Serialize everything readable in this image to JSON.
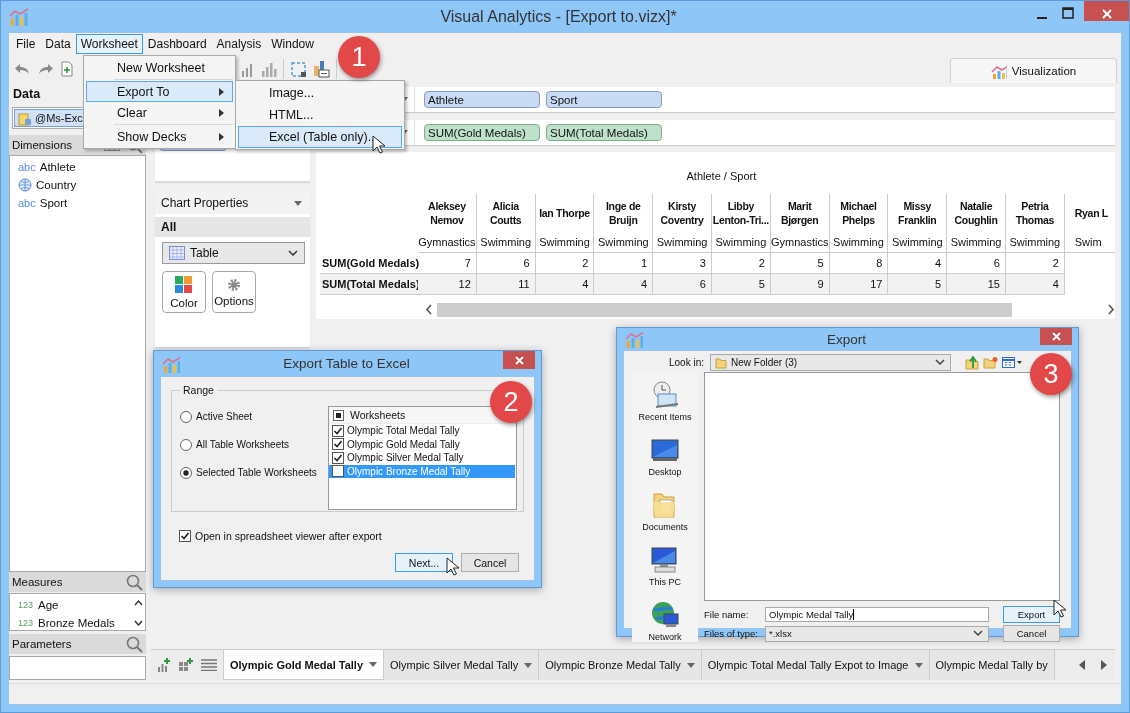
{
  "window": {
    "title": "Visual Analytics - [Export to.vizx]*"
  },
  "menu_bar": [
    {
      "label": "File",
      "selected": false
    },
    {
      "label": "Data",
      "selected": false
    },
    {
      "label": "Worksheet",
      "selected": true
    },
    {
      "label": "Dashboard",
      "selected": false
    },
    {
      "label": "Analysis",
      "selected": false
    },
    {
      "label": "Window",
      "selected": false
    }
  ],
  "worksheet_menu": [
    {
      "label": "New Worksheet",
      "submenu": false,
      "selected": false,
      "separator_after": true
    },
    {
      "label": "Export To",
      "submenu": true,
      "selected": true,
      "separator_after": false
    },
    {
      "label": "Clear",
      "submenu": true,
      "selected": false,
      "separator_after": true
    },
    {
      "label": "Show Decks",
      "submenu": true,
      "selected": false,
      "separator_after": false
    }
  ],
  "export_submenu": [
    {
      "label": "Image...",
      "selected": false
    },
    {
      "label": "HTML...",
      "selected": false
    },
    {
      "label": "Excel (Table only)...",
      "selected": true
    }
  ],
  "view_tab": {
    "label": "Visualization",
    "selected": true
  },
  "data_panel": {
    "title": "Data",
    "source": "@Ms-Exc"
  },
  "dimensions": {
    "title": "Dimensions",
    "items": [
      {
        "label": "Athlete",
        "kind": "text",
        "type_label": "abc"
      },
      {
        "label": "Country",
        "kind": "geo"
      },
      {
        "label": "Sport",
        "kind": "text",
        "type_label": "abc"
      }
    ]
  },
  "measures": {
    "title": "Measures",
    "items": [
      {
        "label": "Age",
        "type_label": "123"
      },
      {
        "label": "Bronze Medals",
        "type_label": "123"
      }
    ]
  },
  "parameters": {
    "title": "Parameters"
  },
  "marks_pill": {
    "kind": "dimension"
  },
  "shelves": [
    {
      "pills": [
        {
          "label": "Athlete",
          "kind": "dimension"
        },
        {
          "label": "Sport",
          "kind": "dimension"
        }
      ]
    },
    {
      "pills": [
        {
          "label": "SUM(Gold Medals)",
          "kind": "measure"
        },
        {
          "label": "SUM(Total Medals)",
          "kind": "measure"
        }
      ]
    }
  ],
  "chart_properties": {
    "title": "Chart Properties",
    "scope": "All",
    "chart_type": "Table",
    "buttons": [
      {
        "label": "Color",
        "kind": "color"
      },
      {
        "label": "Options",
        "kind": "options"
      }
    ]
  },
  "table": {
    "title": "Athlete / Sport",
    "columns": [
      {
        "athlete": "Aleksey Nemov",
        "sport": "Gymnastics"
      },
      {
        "athlete": "Alicia Coutts",
        "sport": "Swimming"
      },
      {
        "athlete": "Ian Thorpe",
        "sport": "Swimming"
      },
      {
        "athlete": "Inge de Bruijn",
        "sport": "Swimming"
      },
      {
        "athlete": "Kirsty Coventry",
        "sport": "Swimming"
      },
      {
        "athlete": "Libby Lenton-Tri...",
        "sport": "Swimming"
      },
      {
        "athlete": "Marit Bjørgen",
        "sport": "Gymnastics"
      },
      {
        "athlete": "Michael Phelps",
        "sport": "Swimming"
      },
      {
        "athlete": "Missy Franklin",
        "sport": "Swimming"
      },
      {
        "athlete": "Natalie Coughlin",
        "sport": "Swimming"
      },
      {
        "athlete": "Petria Thomas",
        "sport": "Swimming"
      },
      {
        "athlete": "Ryan L",
        "sport": "Swim"
      }
    ],
    "rows": [
      {
        "label": "SUM(Gold Medals)",
        "values": [
          "7",
          "6",
          "2",
          "1",
          "3",
          "2",
          "5",
          "8",
          "4",
          "6",
          "2"
        ]
      },
      {
        "label": "SUM(Total Medals)",
        "values": [
          "12",
          "11",
          "4",
          "4",
          "6",
          "5",
          "9",
          "17",
          "5",
          "15",
          "4"
        ]
      }
    ]
  },
  "sheet_tabs": [
    {
      "label": "Olympic Gold Medal Tally",
      "selected": true
    },
    {
      "label": "Olympic Silver Medal Tally",
      "selected": false
    },
    {
      "label": "Olympic Bronze Medal Tally",
      "selected": false
    },
    {
      "label": "Olympic Total Medal Tally Expot to Image",
      "selected": false
    },
    {
      "label": "Olympic Medal Tally by",
      "selected": false
    }
  ],
  "excel_dialog": {
    "title": "Export Table to Excel",
    "group_title": "Range",
    "range_options": [
      {
        "label": "Active Sheet",
        "selected": false
      },
      {
        "label": "All Table Worksheets",
        "selected": false
      },
      {
        "label": "Selected Table Worksheets",
        "selected": true
      }
    ],
    "worksheets_header": "Worksheets",
    "worksheets": [
      {
        "label": "Olympic Total Medal Tally",
        "checked": true,
        "selected": false
      },
      {
        "label": "Olympic Gold Medal Tally",
        "checked": true,
        "selected": false
      },
      {
        "label": "Olympic Silver Medal Tally",
        "checked": true,
        "selected": false
      },
      {
        "label": "Olympic Bronze Medal Tally",
        "checked": false,
        "selected": true
      }
    ],
    "open_viewer": {
      "label": "Open in spreadsheet viewer after export",
      "checked": true
    },
    "buttons": [
      {
        "label": "Next...",
        "default": true
      },
      {
        "label": "Cancel",
        "default": false
      }
    ]
  },
  "file_dialog": {
    "title": "Export",
    "look_in_label": "Look in:",
    "look_in": "New Folder (3)",
    "places": [
      {
        "label": "Recent Items",
        "kind": "recent"
      },
      {
        "label": "Desktop",
        "kind": "desktop"
      },
      {
        "label": "Documents",
        "kind": "documents"
      },
      {
        "label": "This PC",
        "kind": "pc"
      },
      {
        "label": "Network",
        "kind": "network"
      }
    ],
    "file_name_label": "File name:",
    "file_name": "Olympic Medal Tally",
    "file_type_label": "Files of type:",
    "file_type": "*.xlsx",
    "buttons": [
      {
        "label": "Export",
        "default": true
      },
      {
        "label": "Cancel",
        "default": false
      }
    ]
  },
  "steps": [
    "1",
    "2",
    "3"
  ]
}
